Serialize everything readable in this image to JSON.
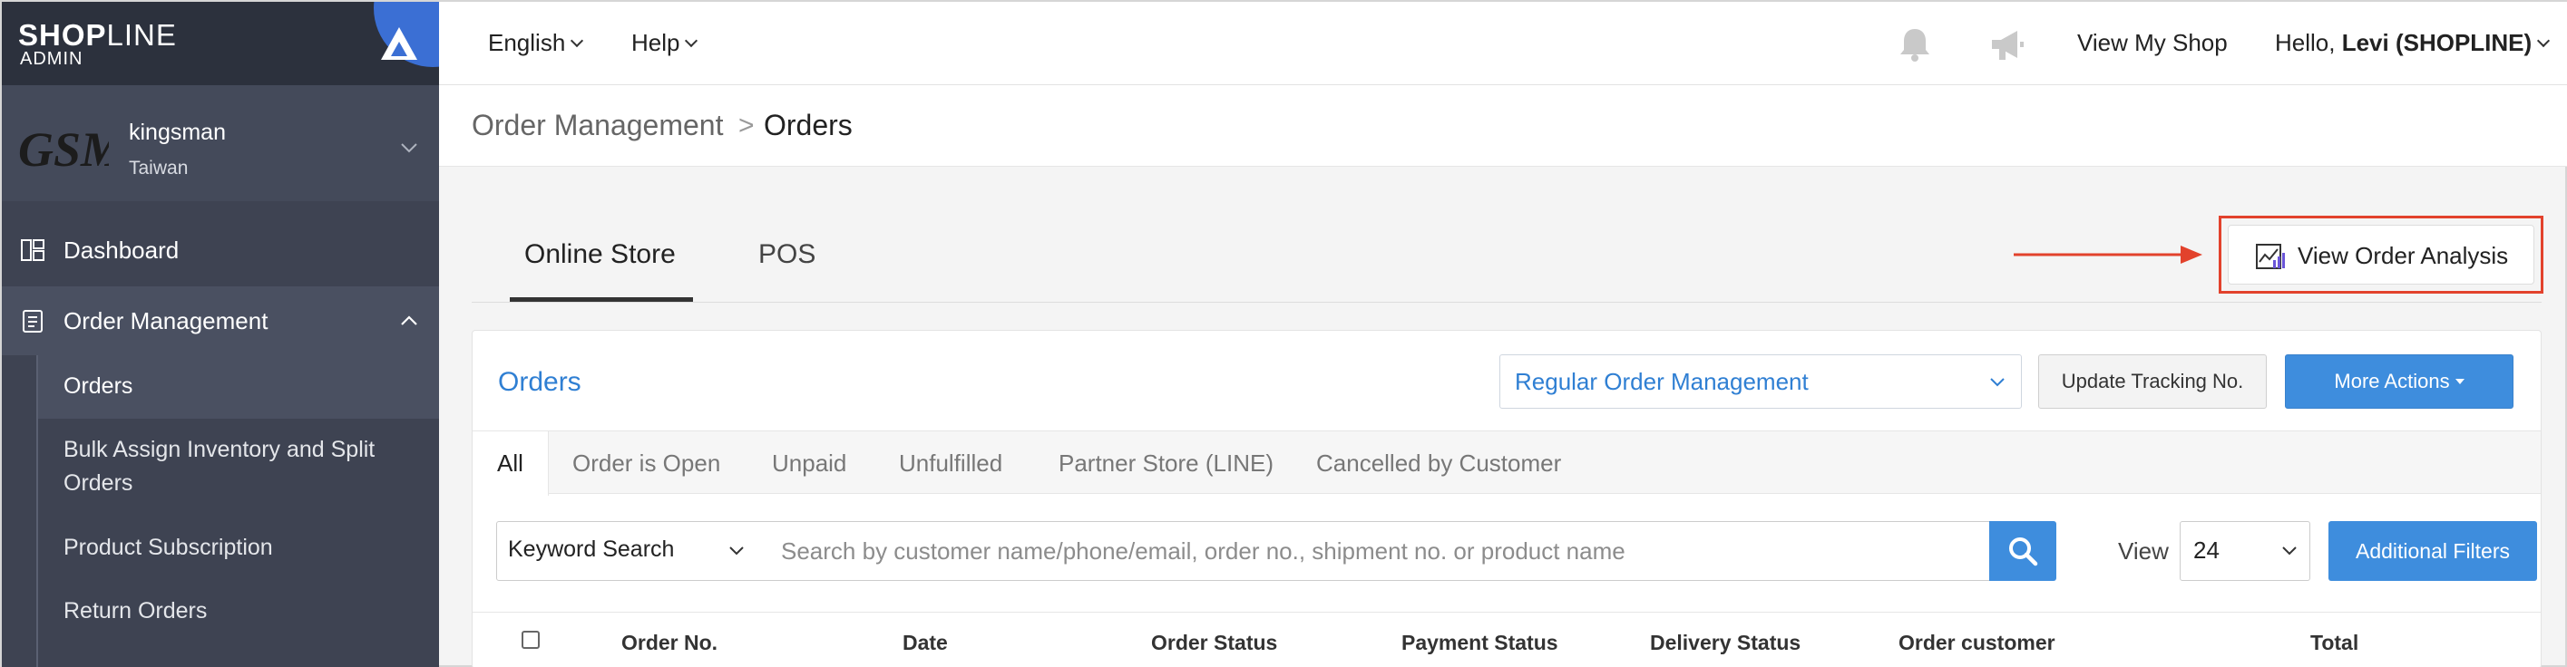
{
  "sidebar": {
    "logo_bold": "SHOP",
    "logo_thin": "LINE",
    "logo_sub": "ADMIN",
    "store": {
      "logo_text": "GSM",
      "name": "kingsman",
      "region": "Taiwan"
    },
    "nav": {
      "dashboard": "Dashboard",
      "order_management": "Order Management"
    },
    "subnav": [
      "Orders",
      "Bulk Assign Inventory and Split Orders",
      "Product Subscription",
      "Return Orders"
    ]
  },
  "topbar": {
    "language": "English",
    "help": "Help",
    "view_shop": "View My Shop",
    "greeting_prefix": "Hello, ",
    "greeting_name": "Levi (SHOPLINE)"
  },
  "breadcrumb": {
    "parent": "Order Management",
    "separator": ">",
    "current": "Orders"
  },
  "channel_tabs": [
    "Online Store",
    "POS"
  ],
  "analysis_button": "View Order Analysis",
  "orders_panel": {
    "title": "Orders",
    "management_select": "Regular Order Management",
    "update_tracking": "Update Tracking No.",
    "more_actions": "More Actions",
    "status_tabs": [
      "All",
      "Order is Open",
      "Unpaid",
      "Unfulfilled",
      "Partner Store (LINE)",
      "Cancelled by Customer"
    ],
    "search": {
      "type": "Keyword Search",
      "placeholder": "Search by customer name/phone/email, order no., shipment no. or product name",
      "view_label": "View",
      "view_value": "24",
      "additional_filters": "Additional Filters"
    },
    "columns": [
      "Order No.",
      "Date",
      "Order Status",
      "Payment Status",
      "Delivery Status",
      "Order customer",
      "Total"
    ]
  },
  "colors": {
    "accent": "#3e8ddd",
    "highlight": "#e2422c",
    "sidebar": "#3e4352"
  }
}
